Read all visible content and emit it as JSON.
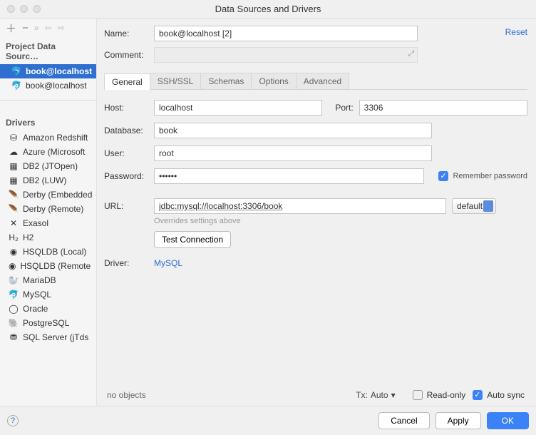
{
  "window": {
    "title": "Data Sources and Drivers"
  },
  "toolbar": {
    "add": "+",
    "remove": "−",
    "reset_link": "Reset"
  },
  "sidebar": {
    "project_header": "Project Data Sourc…",
    "sources": [
      {
        "label": "book@localhost",
        "selected": true
      },
      {
        "label": "book@localhost",
        "selected": false
      }
    ],
    "drivers_header": "Drivers",
    "drivers": [
      "Amazon Redshift",
      "Azure (Microsoft",
      "DB2 (JTOpen)",
      "DB2 (LUW)",
      "Derby (Embedded",
      "Derby (Remote)",
      "Exasol",
      "H2",
      "HSQLDB (Local)",
      "HSQLDB (Remote",
      "MariaDB",
      "MySQL",
      "Oracle",
      "PostgreSQL",
      "SQL Server (jTds"
    ]
  },
  "form": {
    "name_label": "Name:",
    "name_value": "book@localhost [2]",
    "comment_label": "Comment:",
    "tabs": [
      "General",
      "SSH/SSL",
      "Schemas",
      "Options",
      "Advanced"
    ],
    "host_label": "Host:",
    "host_value": "localhost",
    "port_label": "Port:",
    "port_value": "3306",
    "database_label": "Database:",
    "database_value": "book",
    "user_label": "User:",
    "user_value": "root",
    "password_label": "Password:",
    "password_value": "••••••",
    "remember_label": "Remember password",
    "url_label": "URL:",
    "url_value": "jdbc:mysql://localhost:3306/book",
    "url_mode": "default",
    "url_hint": "Overrides settings above",
    "test_label": "Test Connection",
    "driver_label": "Driver:",
    "driver_value": "MySQL"
  },
  "footer": {
    "no_objects": "no objects",
    "tx_label": "Tx:",
    "tx_value": "Auto",
    "readonly_label": "Read-only",
    "autosync_label": "Auto sync",
    "cancel": "Cancel",
    "apply": "Apply",
    "ok": "OK"
  }
}
